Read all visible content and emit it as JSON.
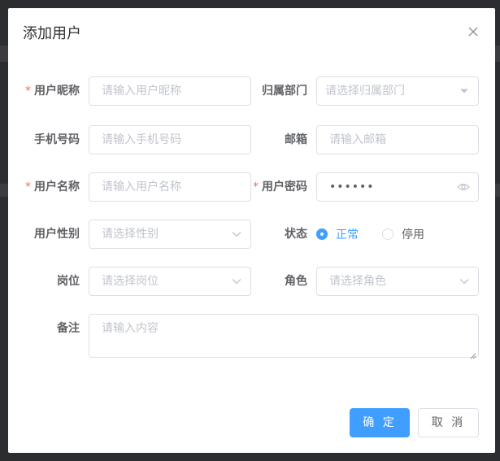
{
  "dialog": {
    "title": "添加用户",
    "close_icon": "close-icon"
  },
  "form": {
    "nickname": {
      "label": "用户昵称",
      "required_mark": "*",
      "placeholder": "请输入用户昵称"
    },
    "department": {
      "label": "归属部门",
      "placeholder": "请选择归属部门"
    },
    "phone": {
      "label": "手机号码",
      "placeholder": "请输入手机号码"
    },
    "email": {
      "label": "邮箱",
      "placeholder": "请输入邮箱"
    },
    "username": {
      "label": "用户名称",
      "required_mark": "*",
      "placeholder": "请输入用户名称"
    },
    "password": {
      "label": "用户密码",
      "required_mark": "*",
      "value": "••••••",
      "toggle_icon": "eye-icon"
    },
    "gender": {
      "label": "用户性别",
      "placeholder": "请选择性别"
    },
    "status": {
      "label": "状态",
      "options": [
        "正常",
        "停用"
      ],
      "selected": "正常"
    },
    "post": {
      "label": "岗位",
      "placeholder": "请选择岗位"
    },
    "role": {
      "label": "角色",
      "placeholder": "请选择角色"
    },
    "remark": {
      "label": "备注",
      "placeholder": "请输入内容"
    }
  },
  "footer": {
    "confirm_label": "确 定",
    "cancel_label": "取 消"
  },
  "colors": {
    "primary": "#409eff",
    "required": "#f56c6c",
    "border": "#dcdfe6",
    "placeholder": "#c0c4cc"
  }
}
